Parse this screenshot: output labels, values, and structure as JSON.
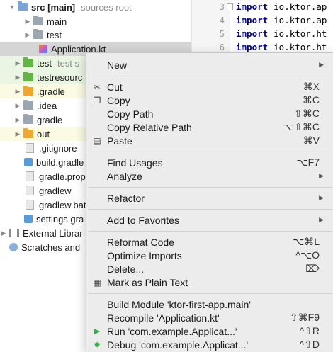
{
  "tree": {
    "rows": [
      {
        "label": "src [main]",
        "hint": "sources root",
        "type": "folder-blue"
      },
      {
        "label": "main",
        "type": "folder-grey"
      },
      {
        "label": "test",
        "type": "folder-grey"
      },
      {
        "label": "Application.kt",
        "type": "kotlin-file"
      },
      {
        "label": "test",
        "hint": "test s",
        "type": "folder-green"
      },
      {
        "label": "testresourc",
        "type": "folder-green"
      },
      {
        "label": ".gradle",
        "type": "folder-orange"
      },
      {
        "label": ".idea",
        "type": "folder-grey"
      },
      {
        "label": "gradle",
        "type": "folder-grey"
      },
      {
        "label": "out",
        "type": "folder-orange"
      },
      {
        "label": ".gitignore",
        "type": "file"
      },
      {
        "label": "build.gradle",
        "type": "gradle-file"
      },
      {
        "label": "gradle.prop",
        "type": "file"
      },
      {
        "label": "gradlew",
        "type": "file"
      },
      {
        "label": "gradlew.bat",
        "type": "file"
      },
      {
        "label": "settings.gra",
        "type": "gradle-file"
      },
      {
        "label": "External Librar",
        "type": "library"
      },
      {
        "label": "Scratches and",
        "type": "scratches"
      }
    ]
  },
  "editor": {
    "lines": [
      {
        "num": "3",
        "kw": "import",
        "text": "io.ktor.ap"
      },
      {
        "num": "4",
        "kw": "import",
        "text": "io.ktor.ap"
      },
      {
        "num": "5",
        "kw": "import",
        "text": "io.ktor.ht"
      },
      {
        "num": "6",
        "kw": "import",
        "text": "io.ktor.ht"
      }
    ]
  },
  "menu": {
    "new": {
      "label": "New"
    },
    "cut": {
      "label": "Cut",
      "shortcut": "⌘X"
    },
    "copy": {
      "label": "Copy",
      "shortcut": "⌘C"
    },
    "copy_path": {
      "label": "Copy Path",
      "shortcut": "⇧⌘C"
    },
    "copy_relative_path": {
      "label": "Copy Relative Path",
      "shortcut": "⌥⇧⌘C"
    },
    "paste": {
      "label": "Paste",
      "shortcut": "⌘V"
    },
    "find_usages": {
      "label": "Find Usages",
      "shortcut": "⌥F7"
    },
    "analyze": {
      "label": "Analyze"
    },
    "refactor": {
      "label": "Refactor"
    },
    "add_to_favorites": {
      "label": "Add to Favorites"
    },
    "reformat_code": {
      "label": "Reformat Code",
      "shortcut": "⌥⌘L"
    },
    "optimize_imports": {
      "label": "Optimize Imports",
      "shortcut": "^⌥O"
    },
    "delete": {
      "label": "Delete...",
      "shortcut": "⌦"
    },
    "mark_as_plain_text": {
      "label": "Mark as Plain Text"
    },
    "build_module": {
      "label": "Build Module 'ktor-first-app.main'"
    },
    "recompile": {
      "label": "Recompile 'Application.kt'",
      "shortcut": "⇧⌘F9"
    },
    "run": {
      "label": "Run 'com.example.Applicat...'",
      "shortcut": "^⇧R"
    },
    "debug": {
      "label": "Debug 'com.example.Applicat...'",
      "shortcut": "^⇧D"
    }
  },
  "colors": {
    "selection": "#d5d5d5",
    "test_bg": "#eaf5e4",
    "excluded_bg": "#fbfbe4",
    "run_green": "#3ba84b",
    "keyword": "#000080"
  }
}
